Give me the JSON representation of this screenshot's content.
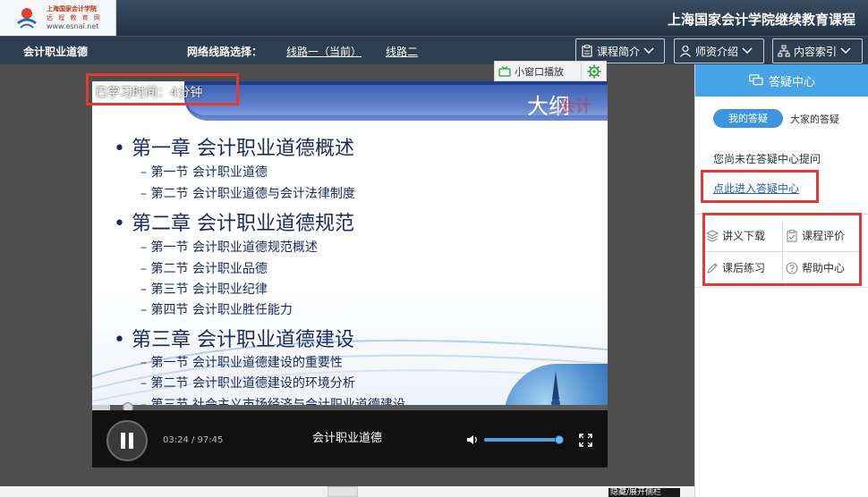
{
  "header": {
    "logo_line1": "上海国家会计学院",
    "logo_line2": "远 程 教 育 网",
    "logo_line3": "www.esnai.net",
    "site_title": "上海国家会计学院继续教育课程"
  },
  "nav": {
    "course_name": "会计职业道德",
    "route_label": "网络线路选择：",
    "route_1": "线路一（当前）",
    "route_2": "线路二",
    "buttons": [
      {
        "label": "课程简介",
        "icon": "clipboard-icon"
      },
      {
        "label": "师资介绍",
        "icon": "person-icon"
      },
      {
        "label": "内容索引",
        "icon": "sitemap-icon"
      }
    ]
  },
  "player": {
    "mini_window": "小窗口播放",
    "study_time": "已学习时间：4分钟",
    "current_time": "03:24",
    "total_time": "97:45",
    "time_display": "03:24 / 97:45",
    "video_title": "会计职业道德",
    "progress": 0.035,
    "volume": 1.0
  },
  "slide": {
    "title": "大纲",
    "watermark": "会计",
    "lines": [
      {
        "level": "chapter",
        "text": "•  第一章 会计职业道德概述"
      },
      {
        "level": "section",
        "text": "–  第一节 会计职业道德"
      },
      {
        "level": "section",
        "text": "–  第二节 会计职业道德与会计法律制度"
      },
      {
        "level": "chapter",
        "text": "•  第二章 会计职业道德规范"
      },
      {
        "level": "section",
        "text": "–  第一节 会计职业道德规范概述"
      },
      {
        "level": "section",
        "text": "–  第二节 会计职业品德"
      },
      {
        "level": "section",
        "text": "–  第三节 会计职业纪律"
      },
      {
        "level": "section",
        "text": "–  第四节 会计职业胜任能力"
      },
      {
        "level": "chapter",
        "text": "•  第三章 会计职业道德建设"
      },
      {
        "level": "section",
        "text": "–  第一节 会计职业道德建设的重要性"
      },
      {
        "level": "section",
        "text": "–  第二节 会计职业道德建设的环境分析"
      },
      {
        "level": "section",
        "text": "–  第三节 社会主义市场经济与会计职业道德建设"
      }
    ]
  },
  "sidebar": {
    "qa_title": "答疑中心",
    "tab_mine": "我的答疑",
    "tab_all": "大家的答疑",
    "empty_text": "您尚未在答疑中心提问",
    "enter_link": "点此进入答疑中心",
    "tools": [
      {
        "label": "讲义下载",
        "icon": "stack-icon"
      },
      {
        "label": "课程评价",
        "icon": "checklist-icon"
      },
      {
        "label": "课后练习",
        "icon": "pencil-icon"
      },
      {
        "label": "帮助中心",
        "icon": "help-icon"
      }
    ]
  },
  "footer": {
    "hide_label": "隐藏/展开侧栏"
  },
  "colors": {
    "header_bg": "#2d3e51",
    "accent_blue": "#47a3e8",
    "highlight_red": "#e53935",
    "link_blue": "#1f5fbf"
  }
}
